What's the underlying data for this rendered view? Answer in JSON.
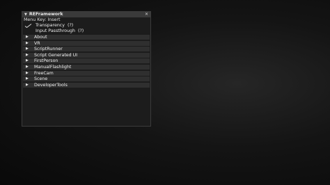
{
  "window": {
    "title": "REFramework",
    "close_symbol": "✕",
    "menu_key": "Menu Key: Insert"
  },
  "options": [
    {
      "label": "Transparency  (?)",
      "checked": true
    },
    {
      "label": "Input Passthrough  (?)",
      "checked": false
    }
  ],
  "sections": [
    {
      "label": "About"
    },
    {
      "label": "VR"
    },
    {
      "label": "ScriptRunner"
    },
    {
      "label": "Script Generated UI"
    },
    {
      "label": "FirstPerson"
    },
    {
      "label": "ManualFlashlight"
    },
    {
      "label": "FreeCam"
    },
    {
      "label": "Scene"
    },
    {
      "label": "DeveloperTools"
    }
  ],
  "icons": {
    "collapse": "triangle-down-icon",
    "expand": "triangle-right-icon",
    "check": "checkmark-icon",
    "close": "close-icon"
  }
}
